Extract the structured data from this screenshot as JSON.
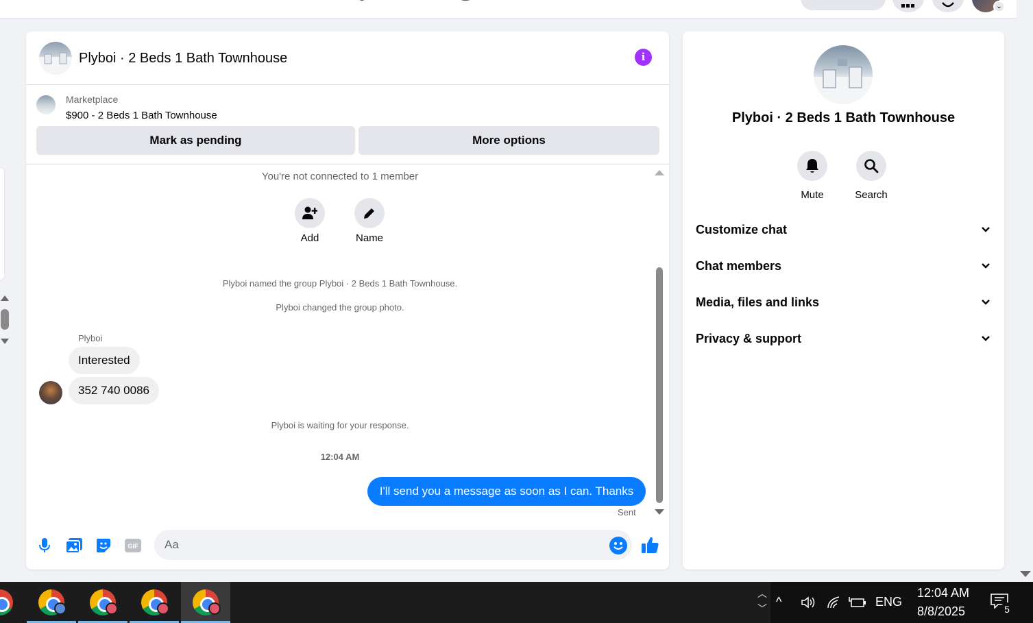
{
  "chat": {
    "title": "Plyboi · 2 Beds 1 Bath Townhouse",
    "marketplace_label": "Marketplace",
    "listing": "$900 - 2 Beds 1 Bath Townhouse",
    "mark_pending": "Mark as pending",
    "more_options": "More options",
    "not_connected": "You're not connected to 1 member",
    "actions": [
      {
        "label": "Add",
        "icon": "add-person-icon"
      },
      {
        "label": "Name",
        "icon": "pencil-icon"
      }
    ],
    "events": [
      "Plyboi named the group Plyboi · 2 Beds 1 Bath Townhouse.",
      "Plyboi changed the group photo."
    ],
    "sender": "Plyboi",
    "incoming": [
      "Interested",
      "352 740 0086"
    ],
    "waiting": "Plyboi is waiting for your response.",
    "time": "12:04 AM",
    "outgoing": "I'll send you a message as soon as I can. Thanks",
    "status": "Sent",
    "placeholder": "Aa",
    "composer_icons": [
      "microphone-icon",
      "photo-icon",
      "sticker-icon",
      "gif-icon",
      "emoji-icon",
      "thumbs-up-icon"
    ]
  },
  "info": {
    "title": "Plyboi · 2 Beds 1 Bath Townhouse",
    "actions": [
      {
        "label": "Mute",
        "icon": "bell-icon"
      },
      {
        "label": "Search",
        "icon": "search-icon"
      }
    ],
    "sections": [
      "Customize chat",
      "Chat members",
      "Media, files and links",
      "Privacy & support"
    ]
  },
  "taskbar": {
    "language": "ENG",
    "time": "12:04 AM",
    "date": "8/8/2025",
    "notifications": "5"
  },
  "colors": {
    "accent": "#0a7cff",
    "info": "#a033ff",
    "like": "#0a7cff"
  }
}
